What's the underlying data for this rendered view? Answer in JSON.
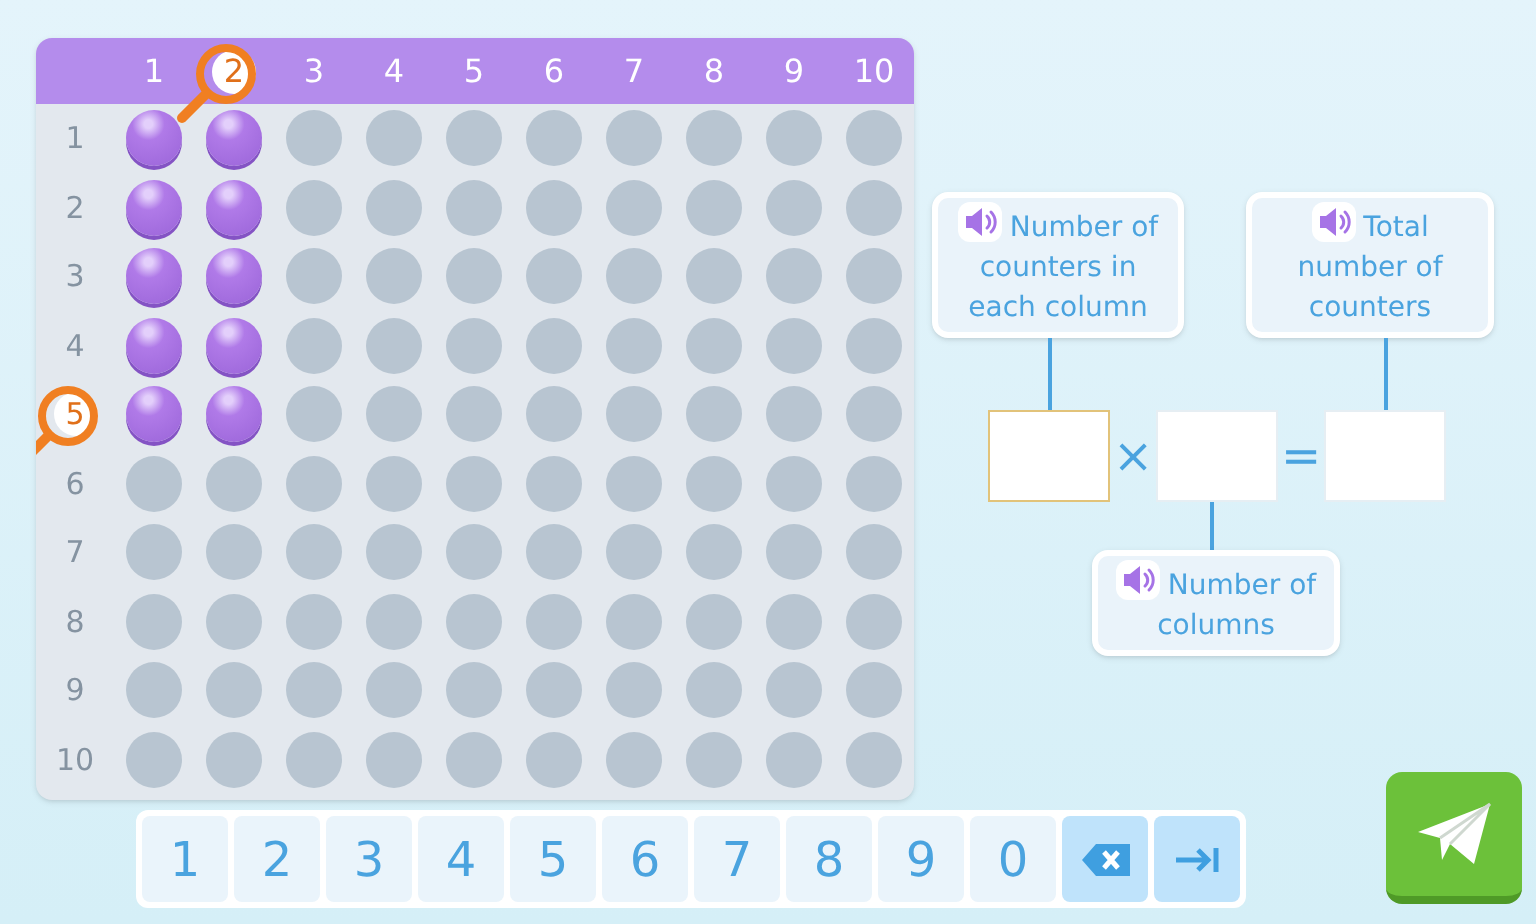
{
  "grid": {
    "columns": [
      {
        "label": "1",
        "highlighted": false
      },
      {
        "label": "2",
        "highlighted": true
      },
      {
        "label": "3",
        "highlighted": false
      },
      {
        "label": "4",
        "highlighted": false
      },
      {
        "label": "5",
        "highlighted": false
      },
      {
        "label": "6",
        "highlighted": false
      },
      {
        "label": "7",
        "highlighted": false
      },
      {
        "label": "8",
        "highlighted": false
      },
      {
        "label": "9",
        "highlighted": false
      },
      {
        "label": "10",
        "highlighted": false
      }
    ],
    "rows": [
      {
        "label": "1",
        "highlighted": false,
        "cells": [
          true,
          true,
          false,
          false,
          false,
          false,
          false,
          false,
          false,
          false
        ]
      },
      {
        "label": "2",
        "highlighted": false,
        "cells": [
          true,
          true,
          false,
          false,
          false,
          false,
          false,
          false,
          false,
          false
        ]
      },
      {
        "label": "3",
        "highlighted": false,
        "cells": [
          true,
          true,
          false,
          false,
          false,
          false,
          false,
          false,
          false,
          false
        ]
      },
      {
        "label": "4",
        "highlighted": false,
        "cells": [
          true,
          true,
          false,
          false,
          false,
          false,
          false,
          false,
          false,
          false
        ]
      },
      {
        "label": "5",
        "highlighted": true,
        "cells": [
          true,
          true,
          false,
          false,
          false,
          false,
          false,
          false,
          false,
          false
        ]
      },
      {
        "label": "6",
        "highlighted": false,
        "cells": [
          false,
          false,
          false,
          false,
          false,
          false,
          false,
          false,
          false,
          false
        ]
      },
      {
        "label": "7",
        "highlighted": false,
        "cells": [
          false,
          false,
          false,
          false,
          false,
          false,
          false,
          false,
          false,
          false
        ]
      },
      {
        "label": "8",
        "highlighted": false,
        "cells": [
          false,
          false,
          false,
          false,
          false,
          false,
          false,
          false,
          false,
          false
        ]
      },
      {
        "label": "9",
        "highlighted": false,
        "cells": [
          false,
          false,
          false,
          false,
          false,
          false,
          false,
          false,
          false,
          false
        ]
      },
      {
        "label": "10",
        "highlighted": false,
        "cells": [
          false,
          false,
          false,
          false,
          false,
          false,
          false,
          false,
          false,
          false
        ]
      }
    ]
  },
  "equation": {
    "labels": [
      {
        "text": "Number of counters in each column"
      },
      {
        "text": "Total number of counters"
      },
      {
        "text": "Number of columns"
      }
    ],
    "fields": [
      {
        "focused": true
      },
      {
        "focused": false
      },
      {
        "focused": false
      }
    ],
    "operators": [
      "×",
      "="
    ]
  },
  "keypad": [
    {
      "kind": "digit",
      "label": "1"
    },
    {
      "kind": "digit",
      "label": "2"
    },
    {
      "kind": "digit",
      "label": "3"
    },
    {
      "kind": "digit",
      "label": "4"
    },
    {
      "kind": "digit",
      "label": "5"
    },
    {
      "kind": "digit",
      "label": "6"
    },
    {
      "kind": "digit",
      "label": "7"
    },
    {
      "kind": "digit",
      "label": "8"
    },
    {
      "kind": "digit",
      "label": "9"
    },
    {
      "kind": "digit",
      "label": "0"
    },
    {
      "kind": "backspace"
    },
    {
      "kind": "next"
    }
  ]
}
